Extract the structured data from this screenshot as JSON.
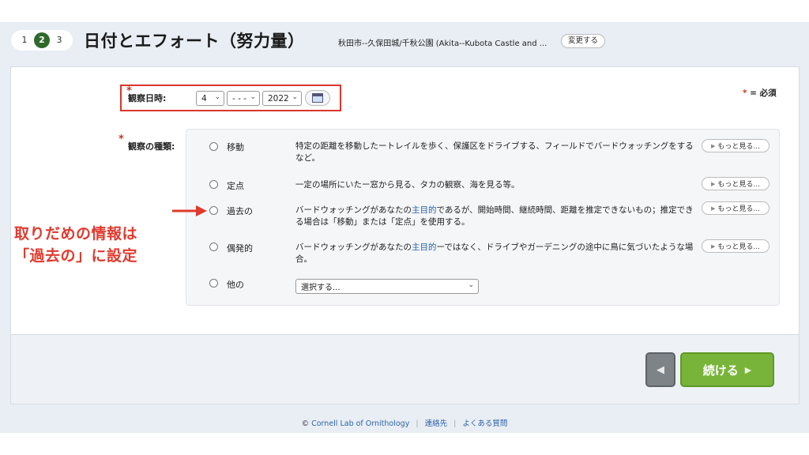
{
  "steps": [
    "1",
    "2",
    "3"
  ],
  "active_step": "2",
  "page_title": "日付とエフォート（努力量）",
  "location": {
    "text": "秋田市--久保田城/千秋公園 (Akita--Kubota Castle and ...",
    "change_label": "変更する"
  },
  "required_note": "= 必須",
  "required_star": "*",
  "date": {
    "label": "観察日時:",
    "month": "4",
    "day": "- - -",
    "year": "2022",
    "calendar_icon": "calendar-icon"
  },
  "observation_type": {
    "label": "観察の種類:",
    "more_label": "もっと見る...",
    "options": [
      {
        "name": "移動",
        "description": "特定の距離を移動したートレイルを歩く、保護区をドライブする、フィールドでバードウォッチングをするなど。"
      },
      {
        "name": "定点",
        "description": "一定の場所にいたー窓から見る、タカの観察、海を見る等。"
      },
      {
        "name": "過去の",
        "description_pre": "バードウォッチングがあなたの",
        "description_link": "主目的",
        "description_post": "であるが、開始時間、継続時間、距離を推定できないもの；推定できる場合は「移動」または「定点」を使用する。"
      },
      {
        "name": "偶発的",
        "description_pre": "バードウォッチングがあなたの",
        "description_link": "主目的",
        "description_post": "ーではなく、ドライブやガーデニングの途中に鳥に気づいたような場合。"
      },
      {
        "name": "他の",
        "select_placeholder": "選択する..."
      }
    ]
  },
  "annotation": {
    "line1": "取りだめの情報は",
    "line2": "「過去の」に設定",
    "color": "#e03a2e"
  },
  "buttons": {
    "back_symbol": "◀",
    "continue_label": "続ける",
    "continue_symbol": "▶"
  },
  "footer": {
    "copyright": "©",
    "lab": "Cornell Lab of Ornithology",
    "contact": "連絡先",
    "faq": "よくある質問"
  },
  "colors": {
    "accent_green": "#78b43a",
    "step_active": "#2e6b2a",
    "link_blue": "#2d63a8",
    "highlight_red": "#d9362b"
  }
}
